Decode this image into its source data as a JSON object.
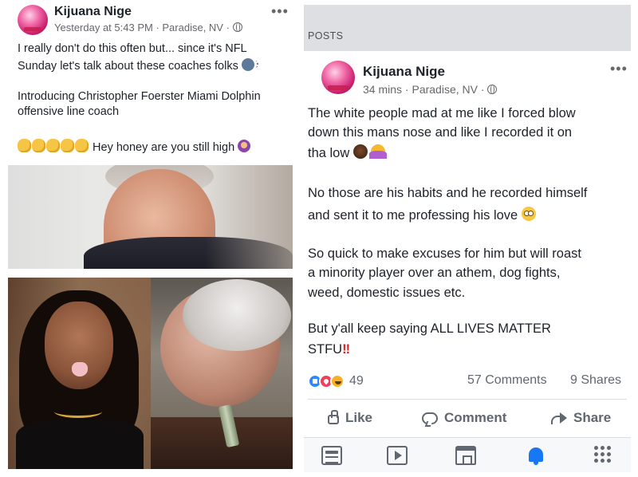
{
  "left_post": {
    "author": "Kijuana Nige",
    "timestamp": "Yesterday at 5:43 PM",
    "location": "Paradise, NV",
    "more": "•••",
    "line1": "I really don't do this often but... since it's NFL",
    "line2": "Sunday let's talk about these coaches folks",
    "line3": "Introducing Christopher Foerster Miami Dolphin",
    "line4": "offensive line coach",
    "line5": "Hey honey are you still high",
    "icons": [
      "clapping-hands-icon",
      "speaking-head-icon",
      "shrug-icon"
    ]
  },
  "right_panel": {
    "section_label": "POSTS",
    "author": "Kijuana Nige",
    "timestamp": "34 mins",
    "location": "Paradise, NV",
    "more": "•••",
    "lines": [
      "The white people mad at me like I forced blow",
      "down this mans nose and like I recorded it on",
      "tha low",
      "No those are his habits and he recorded himself",
      "and sent it to me professing his love",
      "So quick to make excuses for him but will roast",
      "a minority player over an athem, dog fights,",
      "weed, domestic issues etc.",
      "But y'all keep saying ALL LIVES MATTER",
      "STFU"
    ],
    "stfu_suffix": "‼",
    "reactions_count": "49",
    "comments": "57 Comments",
    "shares": "9 Shares",
    "actions": {
      "like": "Like",
      "comment": "Comment",
      "share": "Share"
    },
    "tabs": [
      "news-feed-icon",
      "watch-icon",
      "marketplace-icon",
      "notifications-bell-icon",
      "menu-icon"
    ],
    "accent_color": "#1877f2"
  }
}
